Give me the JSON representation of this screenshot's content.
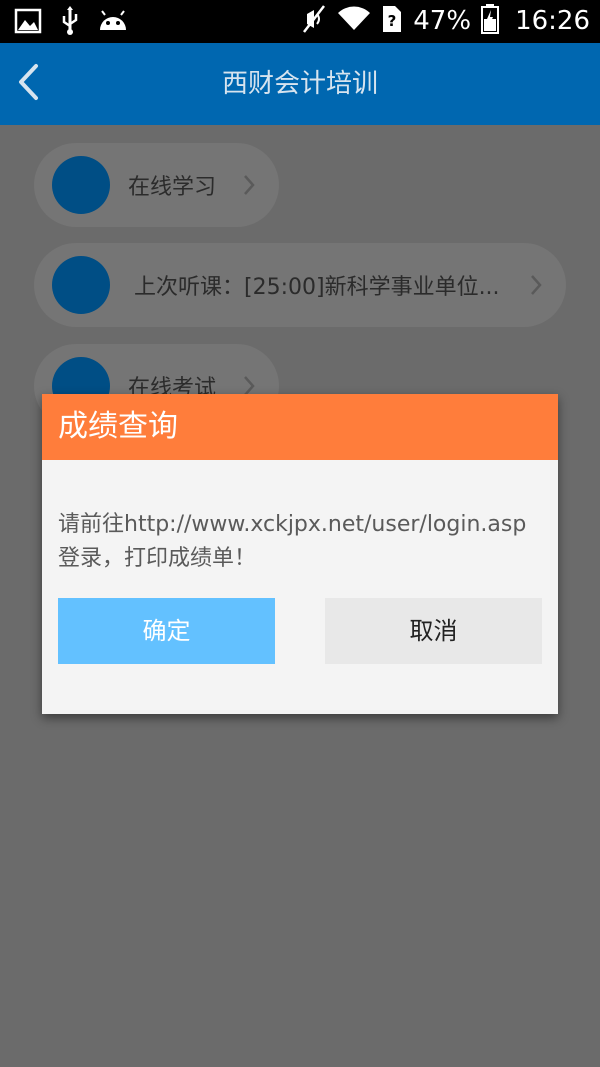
{
  "status_bar": {
    "battery": "47%",
    "time": "16:26",
    "icons": [
      "gallery-icon",
      "usb-icon",
      "android-icon",
      "mute-icon",
      "wifi-icon",
      "sim-icon",
      "battery-icon"
    ]
  },
  "header": {
    "title": "西财会计培训",
    "color": "#0067b0"
  },
  "menu": {
    "items": [
      {
        "label": "在线学习"
      },
      {
        "label": "上次听课：[25:00]新科学事业单位..."
      },
      {
        "label": "在线考试"
      }
    ]
  },
  "dialog": {
    "title": "成绩查询",
    "message": "请前往http://www.xckjpx.net/user/login.asp登录，打印成绩单！",
    "ok_label": "确定",
    "cancel_label": "取消",
    "title_color": "#ff7d3b",
    "ok_color": "#63c1ff"
  }
}
